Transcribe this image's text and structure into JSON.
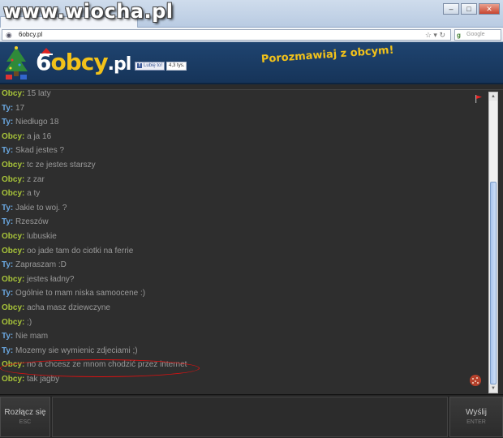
{
  "watermark": "www.wiocha.pl",
  "browser": {
    "url": "6obcy.pl",
    "search_placeholder": "Google"
  },
  "site": {
    "logo_six": "6",
    "logo_rest": "obcy",
    "logo_dot": ".pl",
    "like_label": "Lubię to!",
    "like_count": "4,3 tys.",
    "tagline": "Porozmawiaj z obcym!"
  },
  "colors": {
    "stranger_name": "#a8c43a",
    "you_name": "#6aa6de",
    "message_text": "#9a9a9a",
    "highlight_ellipse": "#dd1111"
  },
  "messages": [
    {
      "who": "Obcy:",
      "type": "obcy",
      "text": "15 laty"
    },
    {
      "who": "Ty:",
      "type": "ty",
      "text": "17"
    },
    {
      "who": "Ty:",
      "type": "ty",
      "text": "Niedługo 18"
    },
    {
      "who": "Obcy:",
      "type": "obcy",
      "text": "a ja 16"
    },
    {
      "who": "Ty:",
      "type": "ty",
      "text": "Skad jestes ?"
    },
    {
      "who": "Obcy:",
      "type": "obcy",
      "text": "tc ze jestes starszy"
    },
    {
      "who": "Obcy:",
      "type": "obcy",
      "text": "z zar"
    },
    {
      "who": "Obcy:",
      "type": "obcy",
      "text": "a ty"
    },
    {
      "who": "Ty:",
      "type": "ty",
      "text": "Jakie to woj. ?"
    },
    {
      "who": "Ty:",
      "type": "ty",
      "text": "Rzeszów"
    },
    {
      "who": "Obcy:",
      "type": "obcy",
      "text": "lubuskie"
    },
    {
      "who": "Obcy:",
      "type": "obcy",
      "text": "oo jade tam do ciotki na ferrie"
    },
    {
      "who": "Ty:",
      "type": "ty",
      "text": "Zapraszam :D"
    },
    {
      "who": "Obcy:",
      "type": "obcy",
      "text": "jestes ładny?"
    },
    {
      "who": "Ty:",
      "type": "ty",
      "text": "Ogólnie to mam niska samoocene :)"
    },
    {
      "who": "Obcy:",
      "type": "obcy",
      "text": "acha masz dziewczyne"
    },
    {
      "who": "Obcy:",
      "type": "obcy",
      "text": ";)"
    },
    {
      "who": "Ty:",
      "type": "ty",
      "text": "Nie mam"
    },
    {
      "who": "Ty:",
      "type": "ty",
      "text": "Mozemy sie wymienic zdjeciami ;)"
    },
    {
      "who": "Obcy:",
      "type": "obcy",
      "text": "no a chcesz ze mnom chodzić przez internet"
    },
    {
      "who": "Obcy:",
      "type": "obcy",
      "text": "tak jagby"
    }
  ],
  "controls": {
    "disconnect_label": "Rozłącz się",
    "disconnect_hint": "ESC",
    "send_label": "Wyślij",
    "send_hint": "ENTER"
  }
}
